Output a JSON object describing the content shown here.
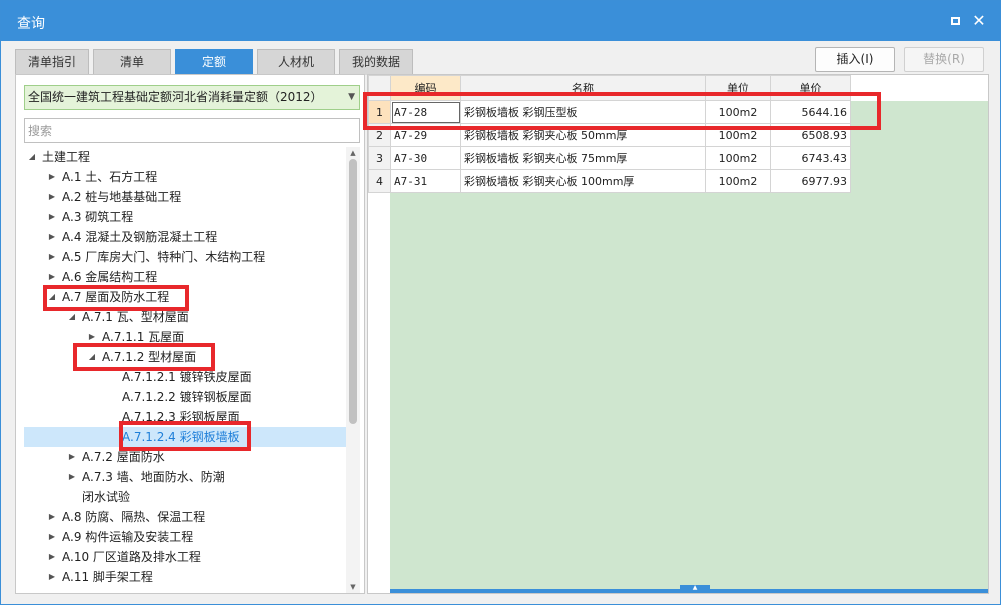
{
  "window": {
    "title": "查询"
  },
  "tabs": [
    {
      "label": "清单指引",
      "active": false
    },
    {
      "label": "清单",
      "active": false
    },
    {
      "label": "定额",
      "active": true
    },
    {
      "label": "人材机",
      "active": false
    },
    {
      "label": "我的数据",
      "active": false
    }
  ],
  "actions": {
    "insert": "插入(I)",
    "replace": "替换(R)"
  },
  "library": {
    "selected": "全国统一建筑工程基础定额河北省消耗量定额（2012）"
  },
  "search": {
    "placeholder": "搜索"
  },
  "tree": [
    {
      "label": "土建工程",
      "state": "expanded"
    },
    {
      "label": "A.1 土、石方工程",
      "state": "collapsed"
    },
    {
      "label": "A.2 桩与地基基础工程",
      "state": "collapsed"
    },
    {
      "label": "A.3 砌筑工程",
      "state": "collapsed"
    },
    {
      "label": "A.4 混凝土及钢筋混凝土工程",
      "state": "collapsed"
    },
    {
      "label": "A.5 厂库房大门、特种门、木结构工程",
      "state": "collapsed"
    },
    {
      "label": "A.6 金属结构工程",
      "state": "collapsed"
    },
    {
      "label": "A.7 屋面及防水工程",
      "state": "expanded"
    },
    {
      "label": "A.7.1 瓦、型材屋面",
      "state": "expanded"
    },
    {
      "label": "A.7.1.1 瓦屋面",
      "state": "collapsed"
    },
    {
      "label": "A.7.1.2 型材屋面",
      "state": "expanded"
    },
    {
      "label": "A.7.1.2.1 镀锌铁皮屋面",
      "state": "leaf"
    },
    {
      "label": "A.7.1.2.2 镀锌钢板屋面",
      "state": "leaf"
    },
    {
      "label": "A.7.1.2.3 彩钢板屋面",
      "state": "leaf"
    },
    {
      "label": "A.7.1.2.4 彩钢板墙板",
      "state": "leaf",
      "selected": true
    },
    {
      "label": "A.7.2 屋面防水",
      "state": "collapsed"
    },
    {
      "label": "A.7.3 墙、地面防水、防潮",
      "state": "collapsed"
    },
    {
      "label": "闭水试验",
      "state": "none"
    },
    {
      "label": "A.8 防腐、隔热、保温工程",
      "state": "collapsed"
    },
    {
      "label": "A.9 构件运输及安装工程",
      "state": "collapsed"
    },
    {
      "label": "A.10 厂区道路及排水工程",
      "state": "collapsed"
    },
    {
      "label": "A.11 脚手架工程",
      "state": "collapsed"
    }
  ],
  "grid": {
    "columns": [
      "编码",
      "名称",
      "单位",
      "单价"
    ],
    "rows": [
      {
        "no": "1",
        "code": "A7-28",
        "name": "彩钢板墙板 彩钢压型板",
        "unit": "100m2",
        "price": "5644.16"
      },
      {
        "no": "2",
        "code": "A7-29",
        "name": "彩钢板墙板 彩钢夹心板 50mm厚",
        "unit": "100m2",
        "price": "6508.93"
      },
      {
        "no": "3",
        "code": "A7-30",
        "name": "彩钢板墙板 彩钢夹心板 75mm厚",
        "unit": "100m2",
        "price": "6743.43"
      },
      {
        "no": "4",
        "code": "A7-31",
        "name": "彩钢板墙板 彩钢夹心板 100mm厚",
        "unit": "100m2",
        "price": "6977.93"
      }
    ]
  },
  "colors": {
    "accent": "#3a8fd9",
    "highlight": "#e8282b",
    "grid_bg": "#cfe6cf",
    "library_bg": "#e4f3d9"
  },
  "icons": {
    "maximize": "maximize-icon",
    "close": "close-icon",
    "expanded": "triangle-expanded-icon",
    "collapsed": "triangle-collapsed-icon"
  }
}
